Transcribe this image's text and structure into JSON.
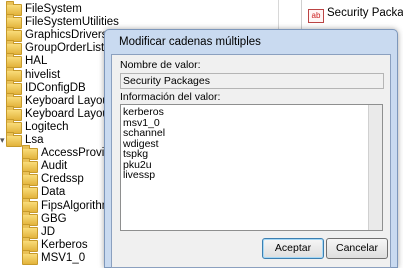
{
  "tree": {
    "items": [
      {
        "label": "FileSystem",
        "depth": 0,
        "expanded": false
      },
      {
        "label": "FileSystemUtilities",
        "depth": 0,
        "expanded": false
      },
      {
        "label": "GraphicsDrivers",
        "depth": 0,
        "expanded": false
      },
      {
        "label": "GroupOrderList",
        "depth": 0,
        "expanded": false
      },
      {
        "label": "HAL",
        "depth": 0,
        "expanded": false
      },
      {
        "label": "hivelist",
        "depth": 0,
        "expanded": false
      },
      {
        "label": "IDConfigDB",
        "depth": 0,
        "expanded": false
      },
      {
        "label": "Keyboard Layout",
        "depth": 0,
        "expanded": false
      },
      {
        "label": "Keyboard Layouts",
        "depth": 0,
        "expanded": false
      },
      {
        "label": "Logitech",
        "depth": 0,
        "expanded": false
      },
      {
        "label": "Lsa",
        "depth": 0,
        "expanded": true
      },
      {
        "label": "AccessProviders",
        "depth": 1,
        "expanded": false
      },
      {
        "label": "Audit",
        "depth": 1,
        "expanded": false
      },
      {
        "label": "Credssp",
        "depth": 1,
        "expanded": false
      },
      {
        "label": "Data",
        "depth": 1,
        "expanded": false
      },
      {
        "label": "FipsAlgorithmPolicy",
        "depth": 1,
        "expanded": false
      },
      {
        "label": "GBG",
        "depth": 1,
        "expanded": false
      },
      {
        "label": "JD",
        "depth": 1,
        "expanded": false
      },
      {
        "label": "Kerberos",
        "depth": 1,
        "expanded": false
      },
      {
        "label": "MSV1_0",
        "depth": 1,
        "expanded": false
      }
    ]
  },
  "right_list": {
    "entry_icon": "ab",
    "entry_label": "Security Packages"
  },
  "dialog": {
    "title": "Modificar cadenas múltiples",
    "name_label": "Nombre de valor:",
    "name_value": "Security Packages",
    "data_label": "Información del valor:",
    "value_lines": [
      "kerberos",
      "msv1_0",
      "schannel",
      "wdigest",
      "tspkg",
      "pku2u",
      "livessp"
    ],
    "ok_label": "Aceptar",
    "cancel_label": "Cancelar"
  }
}
